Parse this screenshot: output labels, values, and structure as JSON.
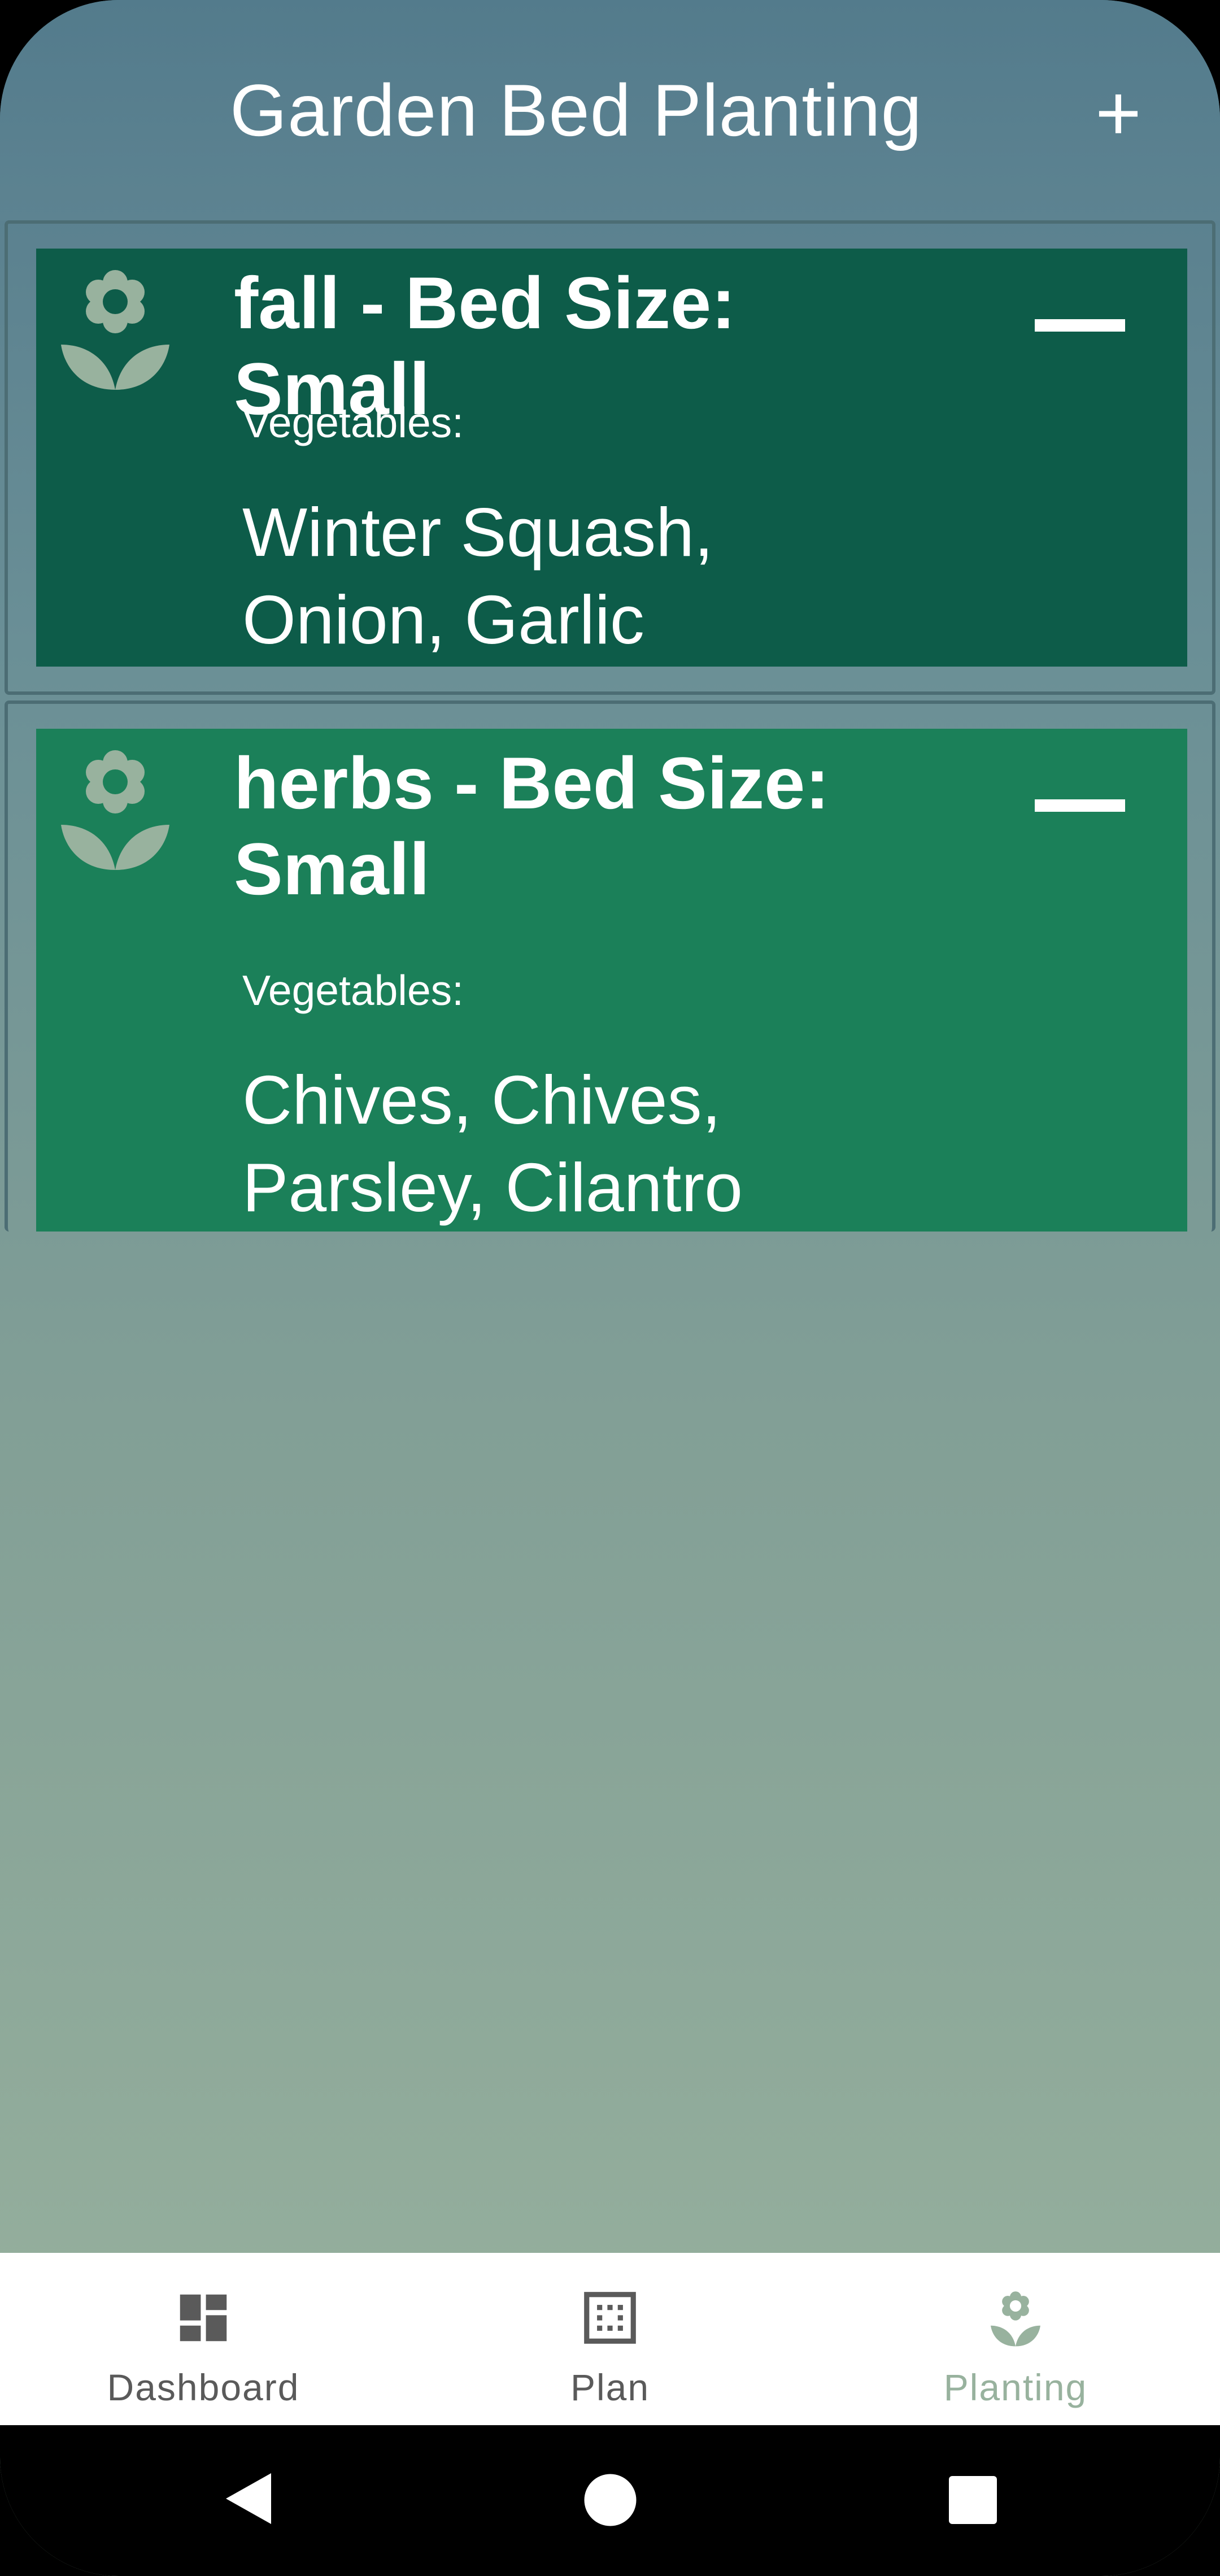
{
  "header": {
    "title": "Garden Bed Planting",
    "add_label": "+"
  },
  "beds": [
    {
      "title": "fall - Bed Size: Small",
      "vegetables_label": "Vegetables:",
      "vegetables": "Winter Squash, Onion, Garlic"
    },
    {
      "title": "herbs - Bed Size: Small",
      "vegetables_label": "Vegetables:",
      "vegetables": "Chives, Chives, Parsley, Cilantro"
    }
  ],
  "nav": [
    {
      "label": "Dashboard",
      "icon": "dashboard-icon"
    },
    {
      "label": "Plan",
      "icon": "grid-icon"
    },
    {
      "label": "Planting",
      "icon": "flower-icon",
      "active": true
    }
  ],
  "colors": {
    "fall_card": "#0d5c49",
    "herbs_card": "#1b8059",
    "active_nav": "#98b29e"
  }
}
